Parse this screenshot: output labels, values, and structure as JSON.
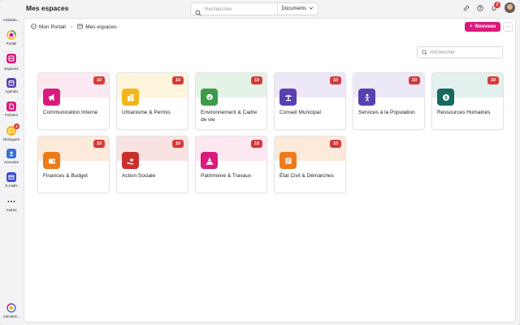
{
  "app": {
    "title": "Mes espaces"
  },
  "search": {
    "placeholder": "Rechercher",
    "scope": "Documents"
  },
  "notifications": {
    "count": "2"
  },
  "sidebar": {
    "items": [
      {
        "label": "Assistan...",
        "icon": "sparkle-icon"
      },
      {
        "label": "Portail",
        "icon": "portal-icon"
      },
      {
        "label": "Espaces",
        "icon": "spaces-icon"
      },
      {
        "label": "Agenda",
        "icon": "calendar-icon"
      },
      {
        "label": "Fichiers",
        "icon": "file-icon"
      },
      {
        "label": "Dialogues",
        "icon": "chat-icon",
        "badge": "2"
      },
      {
        "label": "Annuaire",
        "icon": "directory-icon"
      },
      {
        "label": "E-mails",
        "icon": "mail-icon"
      },
      {
        "label": "Autres",
        "icon": "more-icon"
      },
      {
        "label": "Administ...",
        "icon": "admin-icon"
      }
    ]
  },
  "breadcrumb": {
    "portal": "Mon Portail",
    "current": "Mes espaces"
  },
  "toolbar": {
    "new_label": "Nouveau",
    "more_label": "···"
  },
  "content_search": {
    "placeholder": "Rechercher"
  },
  "cards": [
    {
      "title": "Communication Interne",
      "count": "10",
      "color": "#d81b7c",
      "tint": "#fde7f1",
      "icon": "megaphone-icon"
    },
    {
      "title": "Urbanisme & Permis",
      "count": "10",
      "color": "#f2b51c",
      "tint": "#fdf5dc",
      "icon": "buildings-icon"
    },
    {
      "title": "Environnement & Cadre de vie",
      "count": "10",
      "color": "#3f9a4a",
      "tint": "#e5f2e6",
      "icon": "leaf-icon"
    },
    {
      "title": "Conseil Municipal",
      "count": "10",
      "color": "#5a3fb0",
      "tint": "#ece8f8",
      "icon": "podium-icon"
    },
    {
      "title": "Services à la Population",
      "count": "10",
      "color": "#5a3fb0",
      "tint": "#ece8f8",
      "icon": "person-icon"
    },
    {
      "title": "Ressources Humaines",
      "count": "10",
      "color": "#166a5e",
      "tint": "#e2f0ee",
      "icon": "money-icon"
    },
    {
      "title": "Finances & Budget",
      "count": "10",
      "color": "#ee7a1a",
      "tint": "#fdeadb",
      "icon": "wallet-icon"
    },
    {
      "title": "Action Sociale",
      "count": "10",
      "color": "#c9302c",
      "tint": "#f8e3e2",
      "icon": "hand-heart-icon"
    },
    {
      "title": "Patrimoine & Travaux",
      "count": "10",
      "color": "#d81b7c",
      "tint": "#fde7f1",
      "icon": "cone-icon"
    },
    {
      "title": "État Civil & Démarches",
      "count": "10",
      "color": "#ee7a1a",
      "tint": "#fdeadb",
      "icon": "scroll-icon"
    }
  ]
}
